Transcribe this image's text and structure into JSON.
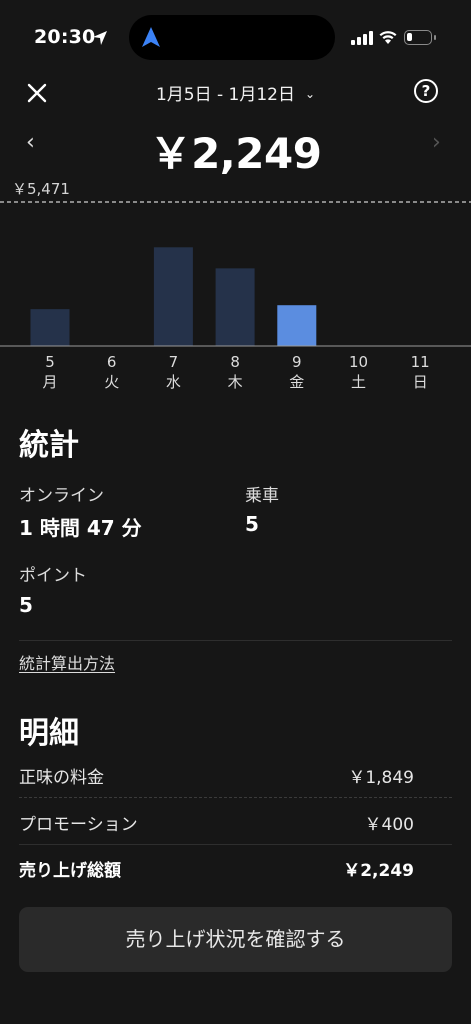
{
  "status_bar": {
    "time": "20:30"
  },
  "header": {
    "date_range": "1月5日 - 1月12日",
    "help_symbol": "?"
  },
  "summary": {
    "total": "￥2,249",
    "max_label": "￥5,471"
  },
  "chart_data": {
    "type": "bar",
    "categories": [
      "5",
      "6",
      "7",
      "8",
      "9",
      "10",
      "11"
    ],
    "weekdays": [
      "月",
      "火",
      "水",
      "木",
      "金",
      "土",
      "日"
    ],
    "values": [
      1400,
      0,
      3750,
      2950,
      1550,
      0,
      0
    ],
    "max_reference": 5471,
    "selected_index": 4,
    "colors": {
      "bar": "#25324a",
      "selected": "#5b8de0",
      "reference_line": "#cfcfcf"
    },
    "ylim": [
      0,
      5471
    ]
  },
  "stats": {
    "title": "統計",
    "online_label": "オンライン",
    "online_value": "1 時間 47 分",
    "rides_label": "乗車",
    "rides_value": "5",
    "points_label": "ポイント",
    "points_value": "5",
    "method_link": "統計算出方法"
  },
  "breakdown": {
    "title": "明細",
    "rows": [
      {
        "label": "正味の料金",
        "value": "￥1,849"
      },
      {
        "label": "プロモーション",
        "value": "￥400"
      },
      {
        "label": "売り上げ総額",
        "value": "￥2,249"
      }
    ]
  },
  "cta_label": "売り上げ状況を確認する"
}
